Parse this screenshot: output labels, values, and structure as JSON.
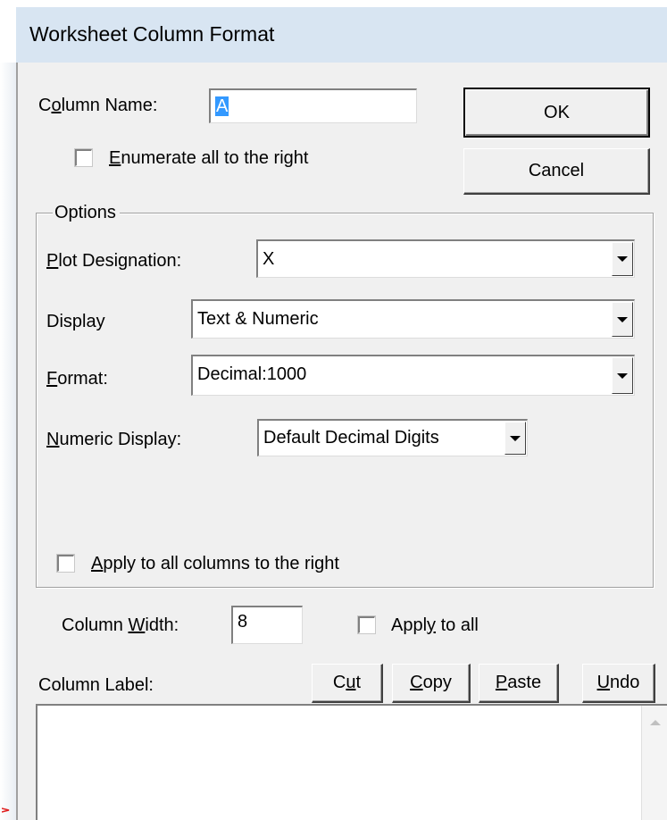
{
  "window": {
    "title": "Worksheet Column Format"
  },
  "column_name": {
    "label_pre": "C",
    "label_underline": "o",
    "label_post": "lumn Name:",
    "value": "A",
    "enumerate": {
      "checked": false,
      "label_underline": "E",
      "label_post": "numerate all to the right"
    }
  },
  "buttons": {
    "ok": "OK",
    "cancel": "Cancel"
  },
  "options": {
    "legend": "Options",
    "plot_designation": {
      "label_underline": "P",
      "label_post": "lot Designation:",
      "value": "X"
    },
    "display": {
      "label": "Display",
      "value": "Text & Numeric"
    },
    "format": {
      "label_underline": "F",
      "label_post": "ormat:",
      "value": "Decimal:1000"
    },
    "numeric_display": {
      "label_underline": "N",
      "label_post": "umeric Display:",
      "value": "Default Decimal Digits"
    },
    "apply_all_right": {
      "checked": false,
      "label_underline": "A",
      "label_post": "pply to all columns to the right"
    }
  },
  "column_width": {
    "label_pre": "Column ",
    "label_underline": "W",
    "label_post": "idth:",
    "value": "8",
    "apply_all": {
      "checked": false,
      "label_pre": "Appl",
      "label_underline": "y",
      "label_post": " to all"
    }
  },
  "column_label": {
    "label": "Column Label:",
    "value": "",
    "cut": {
      "pre": "C",
      "underline": "u",
      "post": "t"
    },
    "copy": {
      "pre": "",
      "underline": "C",
      "post": "opy"
    },
    "paste": {
      "pre": "",
      "underline": "P",
      "post": "aste"
    },
    "undo": {
      "pre": "",
      "underline": "U",
      "post": "ndo"
    }
  },
  "colors": {
    "title_bar": "#d8e5f2",
    "dialog_face": "#f0f0f0",
    "selection": "#3399ff"
  }
}
